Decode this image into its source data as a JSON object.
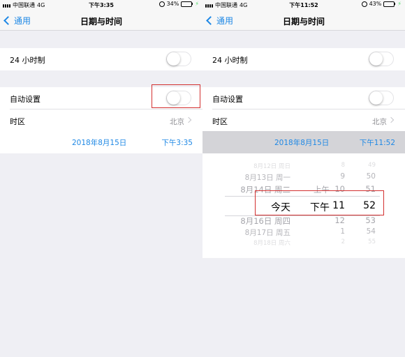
{
  "status_bar": {
    "carrier": "中国联通",
    "network": "4G",
    "left_time": "下午3:35",
    "right_time": "下午11:52",
    "left_battery": "34%",
    "right_battery": "43%",
    "left_battery_level": 0.34,
    "right_battery_level": 0.43
  },
  "nav": {
    "back_label": "通用",
    "title": "日期与时间"
  },
  "settings": {
    "hour24_label": "24 小时制",
    "auto_label": "自动设置",
    "timezone_label": "时区",
    "timezone_value": "北京"
  },
  "left_date": {
    "date": "2018年8月15日",
    "time": "下午3:35"
  },
  "right_date": {
    "date": "2018年8月15日",
    "time": "下午11:52"
  },
  "picker": {
    "dates": [
      "8月12日 周日",
      "8月13日 周一",
      "8月14日 周二",
      "今天",
      "8月16日 周四",
      "8月17日 周五",
      "8月18日 周六"
    ],
    "ampm": [
      "上午",
      "下午"
    ],
    "hours": [
      "8",
      "9",
      "10",
      "11",
      "12",
      "1",
      "2"
    ],
    "minutes": [
      "49",
      "50",
      "51",
      "52",
      "53",
      "54",
      "55"
    ]
  },
  "colors": {
    "accent": "#1e88e5",
    "annotation": "#d32f2f",
    "charging": "#4cd964"
  }
}
